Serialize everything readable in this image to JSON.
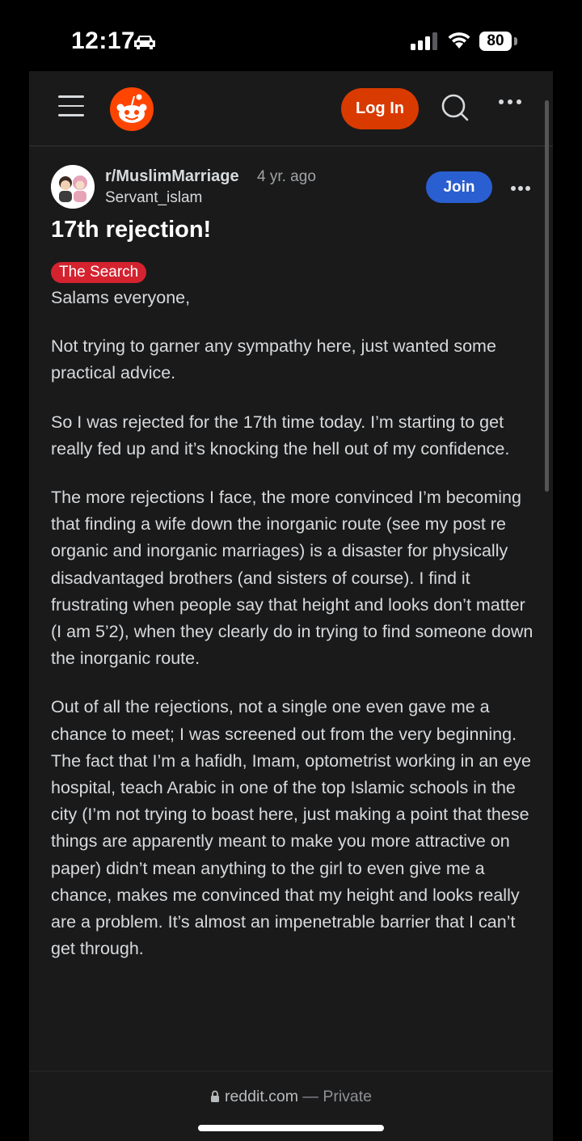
{
  "status_bar": {
    "time": "12:17",
    "battery": "80"
  },
  "navbar": {
    "login_label": "Log In"
  },
  "post": {
    "subreddit": "r/MuslimMarriage",
    "age": "4 yr. ago",
    "username": "Servant_islam",
    "join_label": "Join",
    "title": "17th rejection!",
    "flair": "The Search",
    "paragraphs": [
      "Salams everyone,",
      "Not trying to garner any sympathy here, just wanted some practical advice.",
      "So I was rejected for the 17th time today. I’m starting to get really fed up and it’s knocking the hell out of my confidence.",
      "The more rejections I face, the more convinced I’m becoming that finding a wife down the inorganic route (see my post re organic and inorganic marriages) is a disaster for physically disadvantaged brothers (and sisters of course). I find it frustrating when people say that height and looks don’t matter (I am 5’2), when they clearly do in trying to find someone down the inorganic route.",
      "Out of all the rejections, not a single one even gave me a chance to meet; I was screened out from the very beginning. The fact that I’m a hafidh, Imam, optometrist working in an eye hospital, teach Arabic in one of the top Islamic schools in the city (I’m not trying to boast here, just making a point that these things are apparently meant to make you more attractive on paper) didn’t mean anything to the girl to even give me a chance, makes me convinced that my height and looks really are a problem. It’s almost an impenetrable barrier that I can’t get through."
    ],
    "flair_color": "#d4232f"
  },
  "browser": {
    "domain": "reddit.com",
    "privacy": "— Private"
  },
  "colors": {
    "background": "#1a1a1b",
    "accent_login": "#d93a00",
    "join_blue": "#2a5fd1",
    "text": "#d7dadc"
  },
  "icons": [
    "hamburger-menu-icon",
    "reddit-logo-icon",
    "search-icon",
    "more-options-icon",
    "lock-icon",
    "wifi-icon",
    "signal-icon",
    "car-icon"
  ]
}
